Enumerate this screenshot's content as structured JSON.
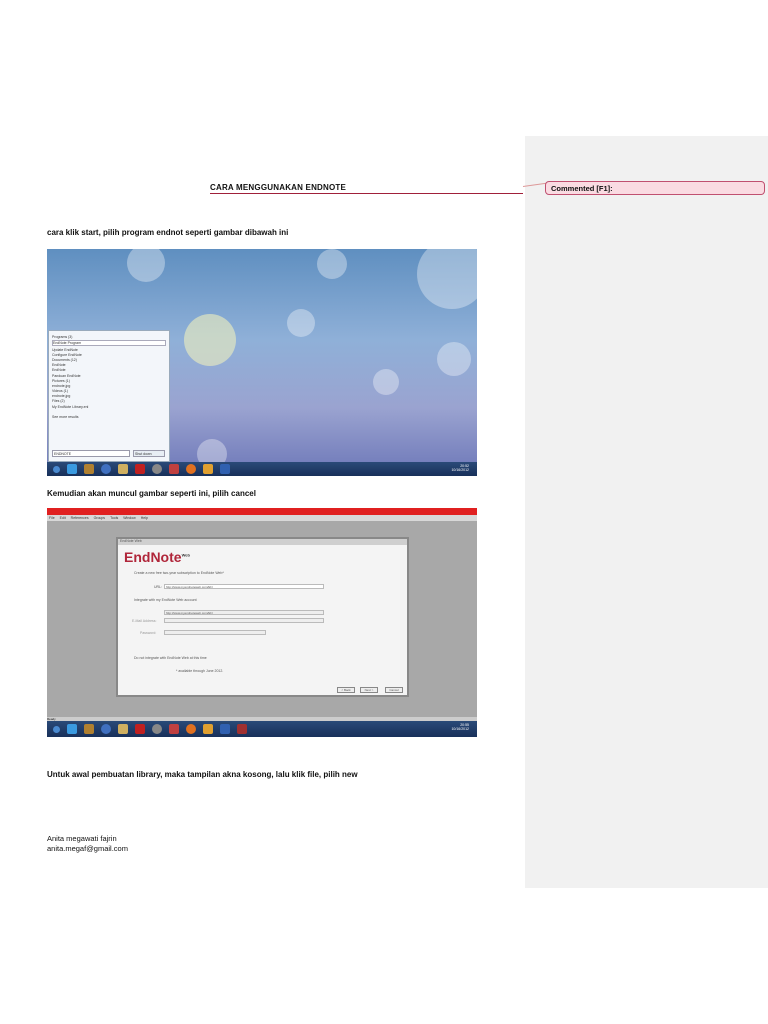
{
  "document": {
    "title": "CARA MENGGUNAKAN ENDNOTE",
    "para1": "cara klik start, pilih program endnot seperti gambar dibawah ini",
    "para2": "Kemudian akan muncul gambar seperti ini, pilih cancel",
    "para3": "Untuk awal pembuatan library, maka tampilan akna kosong, lalu klik file, pilih new",
    "author_name": "Anita megawati fajrin",
    "author_email": "anita.megaf@gmail.com"
  },
  "comment": {
    "label": "Commented [F1]:"
  },
  "screenshot1": {
    "start_menu": [
      "Programs (3)",
      "EndNote Program",
      "Update EndNote",
      "Configure EndNote",
      "Documents (12)",
      "EndNote",
      "EndNote",
      "Panduan EndNote",
      "Pictures (1)",
      "endnote.jpg",
      "Videos (1)",
      "endnote.jpg",
      "Files (2)",
      "My EndNote Library.enl",
      "See more results"
    ],
    "search_value": "ENDNOTE",
    "shutdown": "Shut down",
    "clock_time": "20:52",
    "clock_date": "10/16/2012"
  },
  "screenshot2": {
    "menu": [
      "File",
      "Edit",
      "References",
      "Groups",
      "Tools",
      "Window",
      "Help"
    ],
    "dialog_title": "EndNote Web",
    "logo": "EndNote",
    "logo_sup": "Web",
    "opt1": "Create a new free two-year subscription to EndNote Web*",
    "url_label": "URL:",
    "url_value": "http://www.myendnoteweb.com/EN",
    "opt2": "Integrate with my EndNote Web account",
    "url2_value": "http://www.myendnoteweb.com/EN",
    "email_label": "E-Mail Address:",
    "password_label": "Password:",
    "opt3": "Do not integrate with EndNote Web at this time",
    "note": "* available through June 2012.",
    "back": "< Back",
    "next": "Next >",
    "cancel": "Cancel",
    "status": "Ready",
    "clock_time": "20:55",
    "clock_date": "10/16/2012"
  },
  "colors": {
    "accent": "#a0203a",
    "comment_bg": "#fadbe2",
    "pane": "#f1f1f1"
  }
}
